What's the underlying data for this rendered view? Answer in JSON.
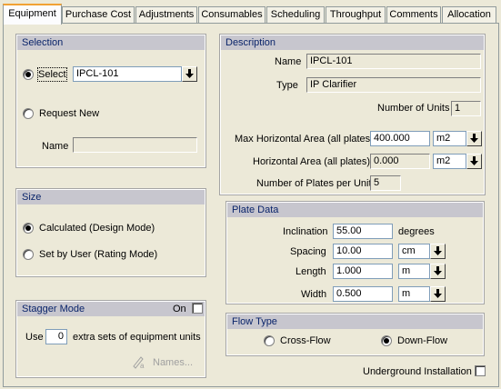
{
  "tabs": [
    "Equipment",
    "Purchase Cost",
    "Adjustments",
    "Consumables",
    "Scheduling",
    "Throughput",
    "Comments",
    "Allocation"
  ],
  "selection": {
    "header": "Selection",
    "select_label": "Select",
    "select_value": "IPCL-101",
    "request_new_label": "Request New",
    "name_label": "Name",
    "name_value": ""
  },
  "size": {
    "header": "Size",
    "calculated_label": "Calculated (Design Mode)",
    "set_by_user_label": "Set by User (Rating Mode)"
  },
  "stagger": {
    "header": "Stagger Mode",
    "on_label": "On",
    "use_label": "Use",
    "use_value": "0",
    "extra_label": "extra sets of equipment units",
    "names_label": "Names..."
  },
  "description": {
    "header": "Description",
    "name_label": "Name",
    "name_value": "IPCL-101",
    "type_label": "Type",
    "type_value": "IP Clarifier",
    "units_label": "Number of Units",
    "units_value": "1",
    "max_area_label": "Max Horizontal Area (all plates)",
    "max_area_value": "400.000",
    "max_area_unit": "m2",
    "area_label": "Horizontal Area (all plates)",
    "area_value": "0.000",
    "area_unit": "m2",
    "plates_label": "Number of Plates per Unit",
    "plates_value": "5"
  },
  "plate": {
    "header": "Plate Data",
    "inclination_label": "Inclination",
    "inclination_value": "55.00",
    "inclination_unit": "degrees",
    "spacing_label": "Spacing",
    "spacing_value": "10.00",
    "spacing_unit": "cm",
    "length_label": "Length",
    "length_value": "1.000",
    "length_unit": "m",
    "width_label": "Width",
    "width_value": "0.500",
    "width_unit": "m"
  },
  "flow": {
    "header": "Flow Type",
    "cross_label": "Cross-Flow",
    "down_label": "Down-Flow"
  },
  "underground_label": "Underground Installation"
}
